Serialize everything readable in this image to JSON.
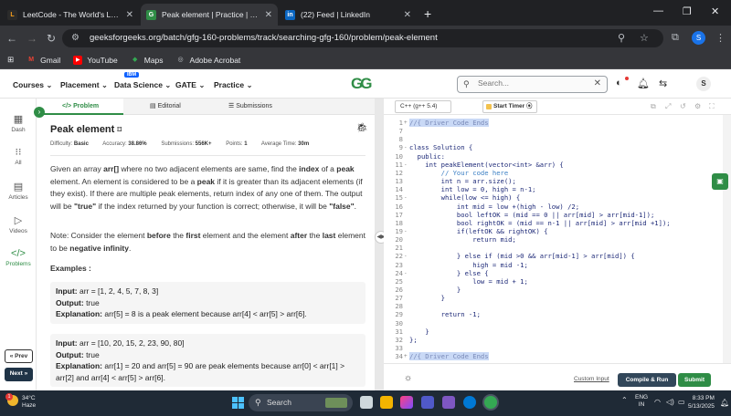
{
  "browser": {
    "tabs": [
      {
        "title": "LeetCode - The World's Leadin",
        "icon": "leetcode-icon",
        "fav": "L",
        "color": "#f89f1b",
        "active": false
      },
      {
        "title": "Peak element | Practice | Geeks",
        "icon": "gfg-icon",
        "fav": "G",
        "color": "#2f8d46",
        "active": true
      },
      {
        "title": "(22) Feed | LinkedIn",
        "icon": "linkedin-icon",
        "fav": "in",
        "color": "#0a66c2",
        "active": false
      }
    ],
    "new_tab": "+",
    "url": "geeksforgeeks.org/batch/gfg-160-problems/track/searching-gfg-160/problem/peak-element",
    "profile_initial": "S",
    "bookmarks": [
      {
        "label": "Gmail",
        "icon": "gmail-icon",
        "fav": "M",
        "color": "#ea4335"
      },
      {
        "label": "YouTube",
        "icon": "youtube-icon",
        "fav": "▶",
        "color": "#ff0000"
      },
      {
        "label": "Maps",
        "icon": "maps-icon",
        "fav": "◆",
        "color": "#34a853"
      },
      {
        "label": "Adobe Acrobat",
        "icon": "acrobat-icon",
        "fav": "◎",
        "color": "#5f6368"
      }
    ]
  },
  "site": {
    "nav": [
      "Courses",
      "Placement",
      "Data Science",
      "GATE",
      "Practice"
    ],
    "ibm_badge": "IBM",
    "logo": "GG",
    "search_placeholder": "Search...",
    "avatar": "S"
  },
  "sidebar": {
    "items": [
      {
        "label": "Dash",
        "icon": "dashboard-icon",
        "glyph": "▦"
      },
      {
        "label": "All",
        "icon": "grid-icon",
        "glyph": "⁝⁝"
      },
      {
        "label": "Articles",
        "icon": "articles-icon",
        "glyph": "▤"
      },
      {
        "label": "Videos",
        "icon": "video-icon",
        "glyph": "▷"
      },
      {
        "label": "Problems",
        "icon": "code-icon",
        "glyph": "</>"
      }
    ],
    "prev": "« Prev",
    "next": "Next »"
  },
  "problem": {
    "tabs": [
      "Problem",
      "Editorial",
      "Submissions"
    ],
    "title": "Peak element",
    "meta": {
      "difficulty_label": "Difficulty:",
      "difficulty": "Basic",
      "accuracy_label": "Accuracy:",
      "accuracy": "38.86%",
      "submissions_label": "Submissions:",
      "submissions": "556K+",
      "points_label": "Points:",
      "points": "1",
      "time_label": "Average Time:",
      "time": "30m"
    },
    "desc": {
      "s1": "Given an array ",
      "b1": "arr[]",
      "s2": " where no two adjacent elements are same, find the ",
      "b2": "index",
      "s3": " of a ",
      "b3": "peak",
      "s4": " element. An element is considered to be a ",
      "b4": "peak",
      "s5": " if it is greater than its adjacent elements (if they exist). If there are multiple peak elements, return index of any one of them. The output will be ",
      "b5": "\"true\"",
      "s6": " if the index returned by your function is correct; otherwise, it will be ",
      "b6": "\"false\"",
      "s7": "."
    },
    "note": {
      "s1": "Note: Consider the element ",
      "b1": "before",
      "s2": " the ",
      "b2": "first",
      "s3": " element and the element ",
      "b3": "after",
      "s4": " the ",
      "b4": "last",
      "s5": " element to be ",
      "b5": "negative infinity",
      "s6": "."
    },
    "examples_heading": "Examples :",
    "examples": [
      {
        "input_label": "Input:",
        "input": "arr = [1, 2, 4, 5, 7, 8, 3]",
        "output_label": "Output:",
        "output": "true",
        "expl_label": "Explanation:",
        "expl": "arr[5] = 8 is a peak element because arr[4] < arr[5] > arr[6]."
      },
      {
        "input_label": "Input:",
        "input": "arr = [10, 20, 15, 2, 23, 90, 80]",
        "output_label": "Output:",
        "output": "true",
        "expl_label": "Explanation:",
        "expl": "arr[1] = 20 and arr[5] = 90 are peak elements because arr[0] < arr[1] > arr[2] and arr[4] < arr[5] > arr[6]."
      }
    ]
  },
  "editor": {
    "language": "C++ (g++ 5.4)",
    "timer": "Start Timer",
    "lines": [
      {
        "n": "1",
        "fold": "+",
        "t": "//{ Driver Code Ends",
        "cls": "hl"
      },
      {
        "n": "7",
        "fold": "",
        "t": "",
        "cls": ""
      },
      {
        "n": "8",
        "fold": "",
        "t": "",
        "cls": ""
      },
      {
        "n": "9",
        "fold": "-",
        "t": "class Solution {",
        "cls": ""
      },
      {
        "n": "10",
        "fold": "",
        "t": "  public:",
        "cls": ""
      },
      {
        "n": "11",
        "fold": "-",
        "t": "    int peakElement(vector<int> &arr) {",
        "cls": ""
      },
      {
        "n": "12",
        "fold": "",
        "t": "        // Your code here",
        "cls": "cmt"
      },
      {
        "n": "13",
        "fold": "",
        "t": "        int n = arr.size();",
        "cls": ""
      },
      {
        "n": "14",
        "fold": "",
        "t": "        int low = 0, high = n-1;",
        "cls": ""
      },
      {
        "n": "15",
        "fold": "-",
        "t": "        while(low <= high) {",
        "cls": ""
      },
      {
        "n": "16",
        "fold": "",
        "t": "            int mid = low +(high - low) /2;",
        "cls": ""
      },
      {
        "n": "17",
        "fold": "",
        "t": "            bool leftOK = (mid == 0 || arr[mid] > arr[mid-1]);",
        "cls": ""
      },
      {
        "n": "18",
        "fold": "",
        "t": "            bool rightOK = (mid == n-1 || arr[mid] > arr[mid +1]);",
        "cls": ""
      },
      {
        "n": "19",
        "fold": "-",
        "t": "            if(leftOK && rightOK) {",
        "cls": ""
      },
      {
        "n": "20",
        "fold": "",
        "t": "                return mid;",
        "cls": ""
      },
      {
        "n": "21",
        "fold": "",
        "t": "",
        "cls": ""
      },
      {
        "n": "22",
        "fold": "-",
        "t": "            } else if (mid >0 && arr[mid-1] > arr[mid]) {",
        "cls": ""
      },
      {
        "n": "23",
        "fold": "",
        "t": "                high = mid -1;",
        "cls": ""
      },
      {
        "n": "24",
        "fold": "-",
        "t": "            } else {",
        "cls": ""
      },
      {
        "n": "25",
        "fold": "",
        "t": "                low = mid + 1;",
        "cls": ""
      },
      {
        "n": "26",
        "fold": "",
        "t": "            }",
        "cls": ""
      },
      {
        "n": "27",
        "fold": "",
        "t": "        }",
        "cls": ""
      },
      {
        "n": "28",
        "fold": "",
        "t": "",
        "cls": ""
      },
      {
        "n": "29",
        "fold": "",
        "t": "        return -1;",
        "cls": ""
      },
      {
        "n": "30",
        "fold": "",
        "t": "",
        "cls": ""
      },
      {
        "n": "31",
        "fold": "",
        "t": "    }",
        "cls": ""
      },
      {
        "n": "32",
        "fold": "",
        "t": "};",
        "cls": ""
      },
      {
        "n": "33",
        "fold": "",
        "t": "",
        "cls": ""
      },
      {
        "n": "34",
        "fold": "+",
        "t": "//{ Driver Code Ends",
        "cls": "hl"
      }
    ],
    "custom_input": "Custom Input",
    "compile": "Compile & Run",
    "submit": "Submit"
  },
  "taskbar": {
    "temp": "34°C",
    "condition": "Haze",
    "weather_badge": "1",
    "search": "Search",
    "lang1": "ENG",
    "lang2": "IN",
    "time": "8:33 PM",
    "date": "5/13/2025"
  },
  "colors": {
    "accent": "#2f8d46",
    "compile_bg": "#32475a"
  }
}
